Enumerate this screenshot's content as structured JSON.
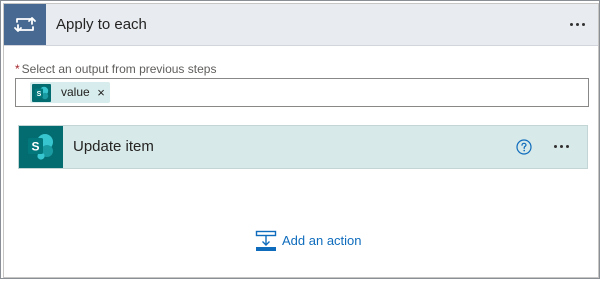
{
  "loop": {
    "title": "Apply to each",
    "icon": "loop-icon",
    "more_icon": "more-options-icon"
  },
  "select_output": {
    "label": "Select an output from previous steps",
    "required_mark": "*",
    "token": {
      "icon": "sharepoint-icon",
      "label": "value",
      "remove_label": "×"
    }
  },
  "action": {
    "title": "Update item",
    "icon": "sharepoint-icon",
    "help_icon": "help-icon",
    "more_icon": "more-options-icon"
  },
  "add_action": {
    "label": "Add an action",
    "icon": "add-action-icon"
  },
  "colors": {
    "header_bg": "#e8ebf0",
    "loop_icon_bg": "#486991",
    "sharepoint_teal": "#036c70",
    "action_bg": "#d7e9e8",
    "link_blue": "#0f6cbd"
  }
}
